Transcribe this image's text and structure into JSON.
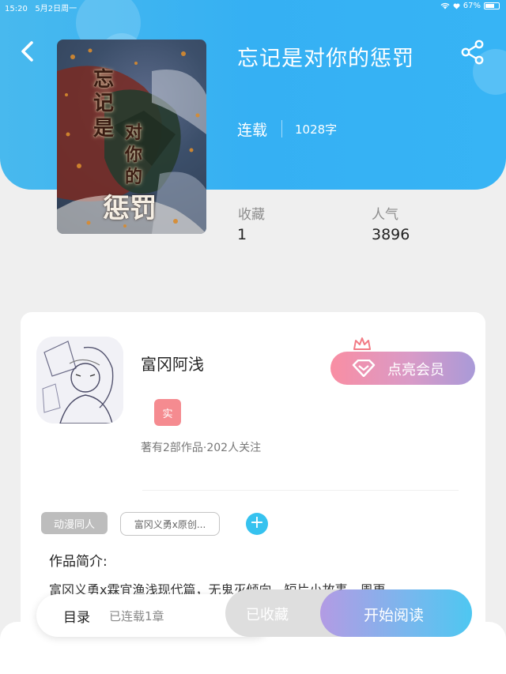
{
  "status_bar": {
    "time": "15:20",
    "date": "5月2日周一",
    "battery": "67%",
    "battery_level": 0.67
  },
  "book": {
    "title": "忘记是对你的惩罚",
    "status": "连载",
    "word_count": "1028字",
    "cover_text": [
      "忘",
      "记",
      "是",
      "对",
      "你",
      "的",
      "惩罚"
    ]
  },
  "stats": [
    {
      "label": "收藏",
      "value": "1"
    },
    {
      "label": "人气",
      "value": "3896"
    }
  ],
  "author": {
    "name": "富冈阿浅",
    "badge": "实",
    "meta": "著有2部作品·202人关注",
    "vip_button": "点亮会员"
  },
  "tags": {
    "category": "动漫同人",
    "topic": "富冈义勇x原创...",
    "add": "+"
  },
  "intro": {
    "heading": "作品简介:",
    "text": "富冈义勇x霖宜渔浅现代篇，无鬼灭倾向，短片小故事，周更，"
  },
  "bottom_bar": {
    "toc_label": "目录",
    "toc_sub": "已连载1章",
    "favorite_button": "已收藏",
    "read_button": "开始阅读"
  },
  "colors": {
    "header_blue": "#37b4f5",
    "vip_pink": "#f98ea3",
    "badge_red": "#f58b90",
    "add_blue": "#36c2ef",
    "read_gradient_end": "#4ec7f1"
  },
  "icons": [
    "back-arrow-icon",
    "share-icon",
    "wifi-icon",
    "heart-icon",
    "battery-icon",
    "diamond-icon",
    "crown-icon",
    "plus-icon"
  ]
}
